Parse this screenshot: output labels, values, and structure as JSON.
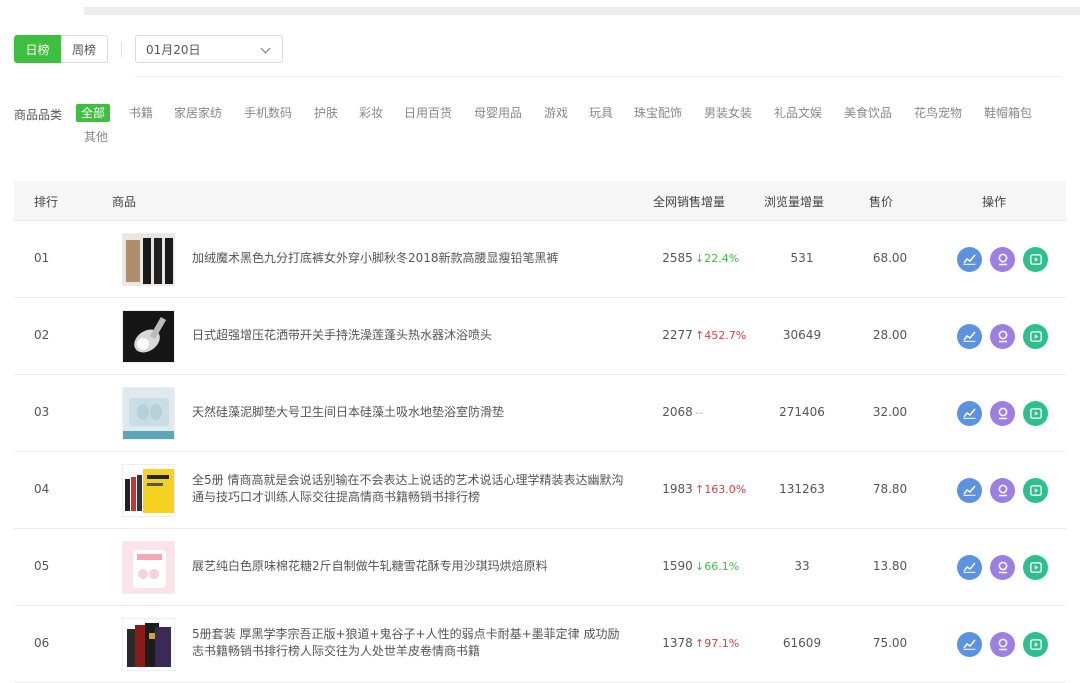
{
  "toggle": {
    "daily": "日榜",
    "weekly": "周榜"
  },
  "date": {
    "value": "01月20日"
  },
  "categories": {
    "label": "商品品类",
    "items": [
      "全部",
      "书籍",
      "家居家纺",
      "手机数码",
      "护肤",
      "彩妆",
      "日用百货",
      "母婴用品",
      "游戏",
      "玩具",
      "珠宝配饰",
      "男装女装",
      "礼品文娱",
      "美食饮品",
      "花鸟宠物",
      "鞋帽箱包",
      "其他"
    ],
    "active": "全部"
  },
  "table": {
    "headers": {
      "rank": "排行",
      "product": "商品",
      "sales": "全网销售增量",
      "views": "浏览量增量",
      "price": "售价",
      "ops": "操作"
    },
    "rows": [
      {
        "rank": "01",
        "title": "加绒魔术黑色九分打底裤女外穿小脚秋冬2018新款高腰显瘦铅笔黑裤",
        "sales": "2585",
        "trend": "↓22.4%",
        "trend_dir": "down",
        "views": "531",
        "price": "68.00"
      },
      {
        "rank": "02",
        "title": "日式超强增压花洒带开关手持洗澡莲蓬头热水器沐浴喷头",
        "sales": "2277",
        "trend": "↑452.7%",
        "trend_dir": "up",
        "views": "30649",
        "price": "28.00"
      },
      {
        "rank": "03",
        "title": "天然硅藻泥脚垫大号卫生间日本硅藻土吸水地垫浴室防滑垫",
        "sales": "2068",
        "trend": "--",
        "trend_dir": "flat",
        "views": "271406",
        "price": "32.00"
      },
      {
        "rank": "04",
        "title": "全5册 情商高就是会说话别输在不会表达上说话的艺术说话心理学精装表达幽默沟通与技巧口才训练人际交往提高情商书籍畅销书排行榜",
        "sales": "1983",
        "trend": "↑163.0%",
        "trend_dir": "up",
        "views": "131263",
        "price": "78.80"
      },
      {
        "rank": "05",
        "title": "展艺纯白色原味棉花糖2斤自制做牛轧糖雪花酥专用沙琪玛烘焙原料",
        "sales": "1590",
        "trend": "↓66.1%",
        "trend_dir": "down",
        "views": "33",
        "price": "13.80"
      },
      {
        "rank": "06",
        "title": "5册套装 厚黑学李宗吾正版+狼道+鬼谷子+人性的弱点卡耐基+墨菲定律 成功励志书籍畅销书排行榜人际交往为人处世羊皮卷情商书籍",
        "sales": "1378",
        "trend": "↑97.1%",
        "trend_dir": "up",
        "views": "61609",
        "price": "75.00"
      }
    ]
  },
  "icons": {
    "op1": "line-chart-icon",
    "op2": "user-search-icon",
    "op3": "play-icon"
  },
  "colors": {
    "accent": "#3fbf3f",
    "up": "#e33b3b",
    "down": "#3fbf3f",
    "op_blue": "#5b93e0",
    "op_purple": "#9d7fe4",
    "op_green": "#2ec08a"
  }
}
